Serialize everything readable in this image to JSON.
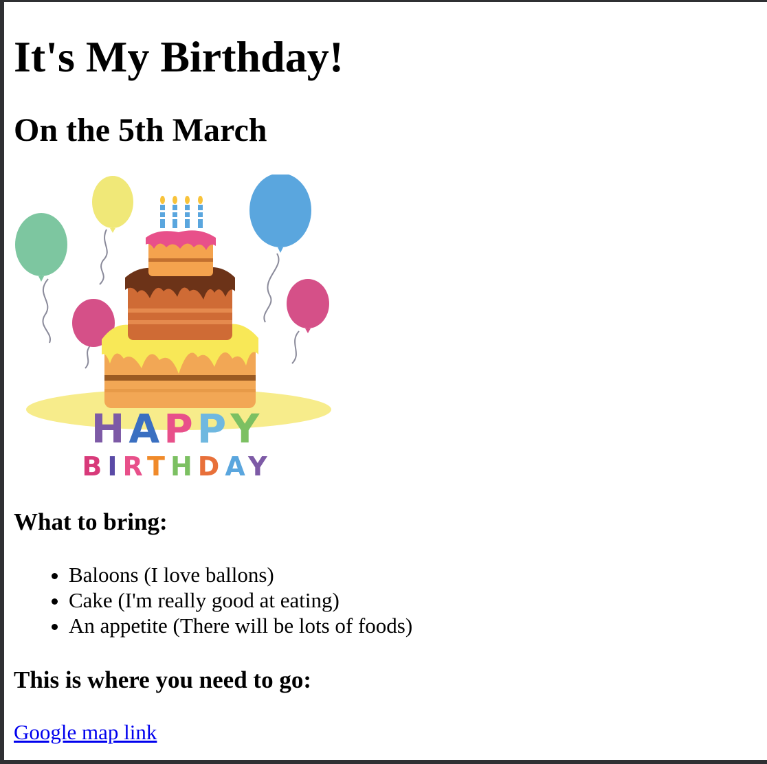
{
  "page": {
    "title": "It's My Birthday!",
    "subtitle": "On the 5th March"
  },
  "image": {
    "banner_word_1": "HAPPY",
    "banner_word_2": "BIRTHDAY",
    "colors": {
      "balloon_green": "#7dc6a0",
      "balloon_yellow": "#f0e878",
      "balloon_blue": "#5aa6de",
      "balloon_pink": "#d55088",
      "cake_top": "#f4a34e",
      "cake_middle": "#cf6b35",
      "cake_bottom": "#f2a755",
      "frosting_pink": "#e8508a",
      "frosting_yellow": "#f8e857",
      "chocolate": "#6c3318",
      "plate": "#f7ec8b"
    }
  },
  "bring": {
    "heading": "What to bring:",
    "items": [
      "Baloons (I love ballons)",
      "Cake (I'm really good at eating)",
      "An appetite (There will be lots of foods)"
    ]
  },
  "directions": {
    "heading": "This is where you need to go:",
    "link_text": "Google map link"
  }
}
